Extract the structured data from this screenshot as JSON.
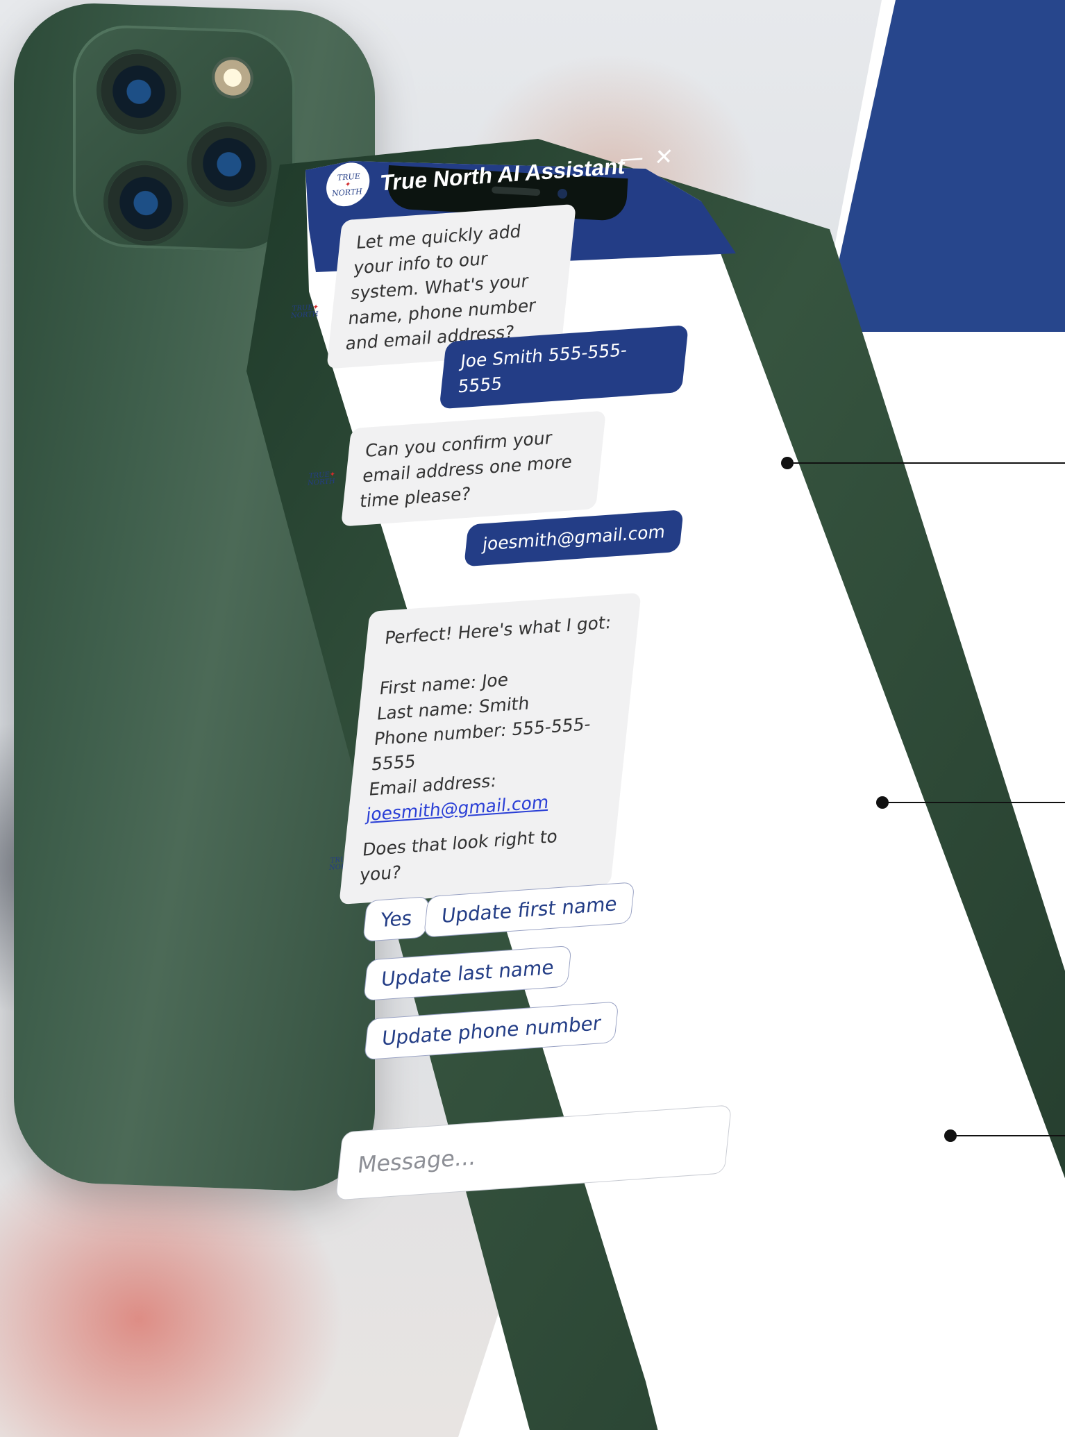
{
  "header": {
    "title": "True North AI Assistant",
    "logo_text_top": "TRUE",
    "logo_text_bottom": "NORTH",
    "minimize_icon": "minimize-icon",
    "close_icon": "close-icon"
  },
  "messages": [
    {
      "from": "bot",
      "text": "Let me quickly add your info to our system. What's your name, phone number and email address?"
    },
    {
      "from": "user",
      "text": "Joe Smith 555-555-5555"
    },
    {
      "from": "bot",
      "text": "Can you confirm your email address one more time please?"
    },
    {
      "from": "user",
      "text": "joesmith@gmail.com"
    },
    {
      "from": "bot",
      "intro": "Perfect! Here's what I got:",
      "first_name": "First name: Joe",
      "last_name": "Last name: Smith",
      "phone": "Phone number: 555-555-5555",
      "email_label": "Email address:",
      "email_link": "joesmith@gmail.com",
      "question": "Does that look right to you?"
    }
  ],
  "quick_replies": [
    "Yes",
    "Update first name",
    "Update last name",
    "Update phone number"
  ],
  "input": {
    "placeholder": "Message..."
  },
  "colors": {
    "brand_blue": "#233d86",
    "accent_blue": "#27468c",
    "leaf_red": "#d32b2b"
  }
}
